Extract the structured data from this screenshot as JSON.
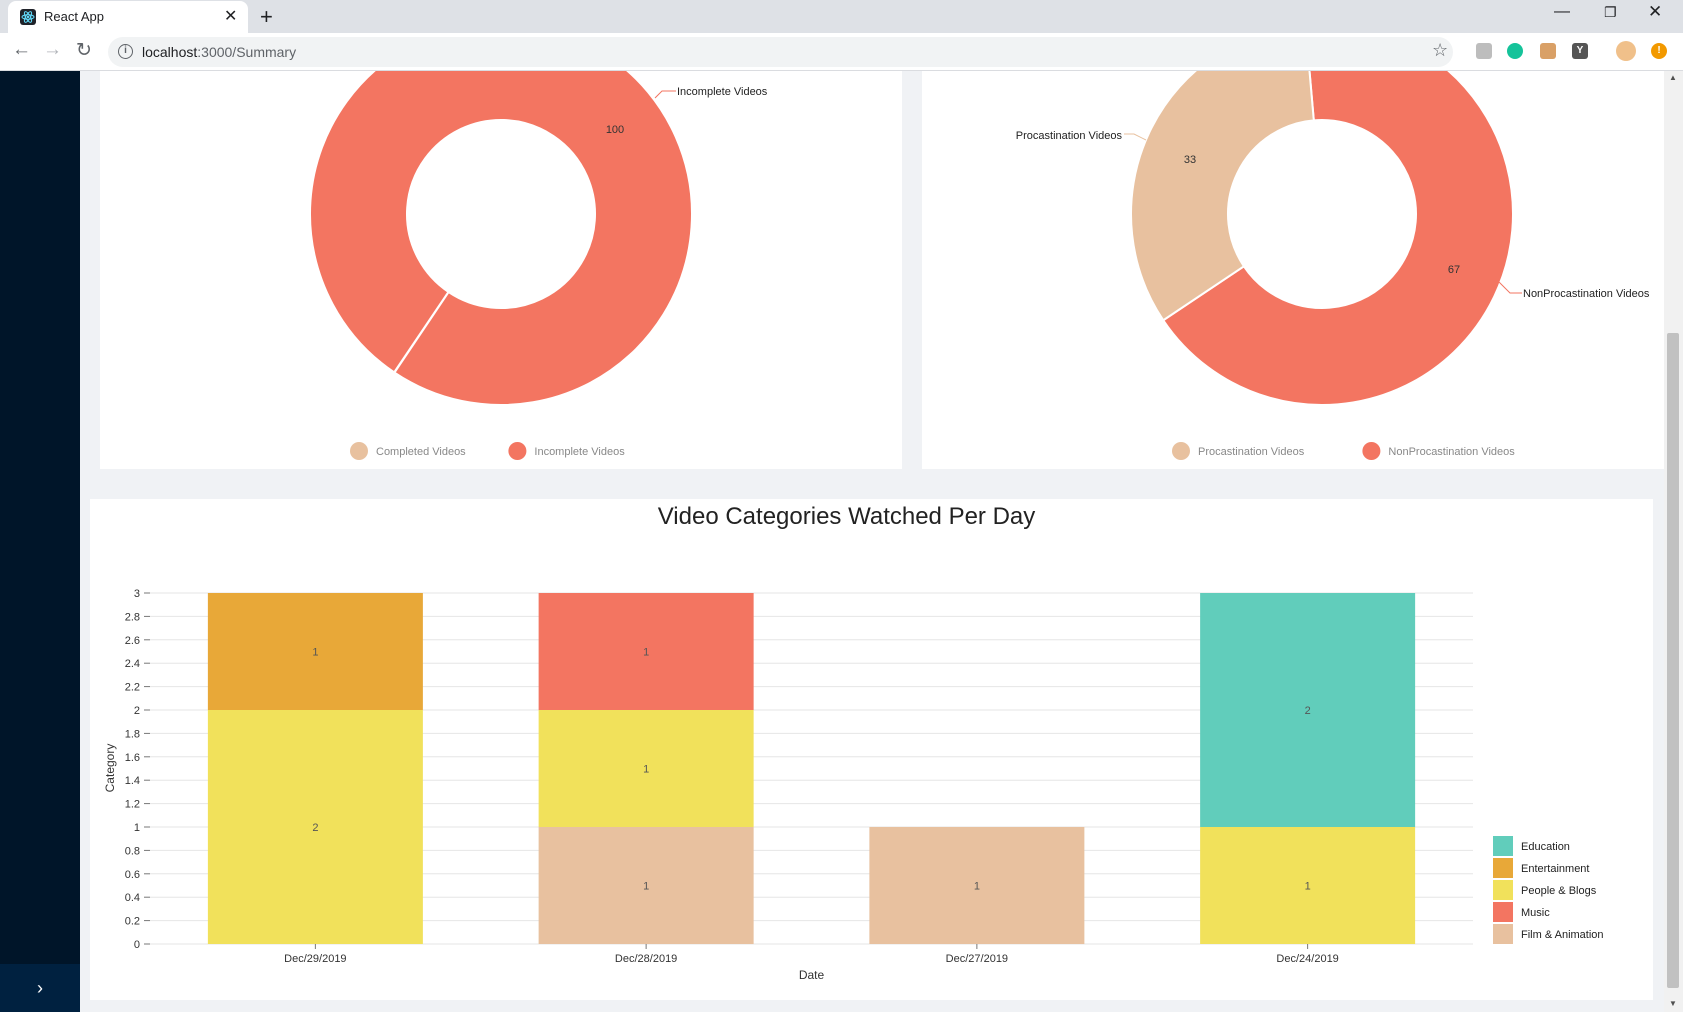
{
  "browser": {
    "tab_title": "React App",
    "url_host": "localhost",
    "url_rest": ":3000/Summary",
    "new_tab": "+",
    "close": "✕",
    "ext_y": "Y"
  },
  "sidebar": {
    "trigger": "›"
  },
  "chart_data": [
    {
      "type": "pie",
      "donut": true,
      "slices": [
        {
          "name": "Completed Videos",
          "value": 0,
          "color": "#e8c19f"
        },
        {
          "name": "Incomplete Videos",
          "value": 100,
          "color": "#f37561"
        }
      ],
      "slice_labels": [
        {
          "name": "Incomplete Videos",
          "value": "100"
        }
      ],
      "legend": [
        "Completed Videos",
        "Incomplete Videos"
      ],
      "legend_position": "bottom"
    },
    {
      "type": "pie",
      "donut": true,
      "slices": [
        {
          "name": "Procastination Videos",
          "value": 33,
          "color": "#e8c19f"
        },
        {
          "name": "NonProcastination Videos",
          "value": 67,
          "color": "#f37561"
        }
      ],
      "legend": [
        "Procastination Videos",
        "NonProcastination Videos"
      ],
      "legend_position": "bottom"
    },
    {
      "type": "bar",
      "stacked": true,
      "title": "Video Categories Watched Per Day",
      "xlabel": "Date",
      "ylabel": "Category",
      "ylim": [
        0,
        3
      ],
      "yticks": [
        "0",
        "0.2",
        "0.4",
        "0.6",
        "0.8",
        "1",
        "1.2",
        "1.4",
        "1.6",
        "1.8",
        "2",
        "2.2",
        "2.4",
        "2.6",
        "2.8",
        "3"
      ],
      "categories": [
        "Dec/29/2019",
        "Dec/28/2019",
        "Dec/27/2019",
        "Dec/24/2019"
      ],
      "series": [
        {
          "name": "Film & Animation",
          "color": "#e8c19f",
          "values": [
            0,
            1,
            1,
            0
          ]
        },
        {
          "name": "People & Blogs",
          "color": "#f1e15b",
          "values": [
            2,
            1,
            0,
            1
          ]
        },
        {
          "name": "Music",
          "color": "#f37561",
          "values": [
            0,
            1,
            0,
            0
          ]
        },
        {
          "name": "Entertainment",
          "color": "#e8a838",
          "values": [
            1,
            0,
            0,
            0
          ]
        },
        {
          "name": "Education",
          "color": "#61cdbb",
          "values": [
            0,
            0,
            0,
            2
          ]
        }
      ],
      "legend": [
        "Education",
        "Entertainment",
        "People & Blogs",
        "Music",
        "Film & Animation"
      ],
      "legend_position": "right",
      "grid": true
    }
  ]
}
